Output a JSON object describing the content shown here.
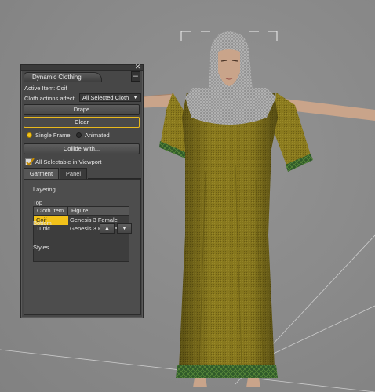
{
  "panel": {
    "title": "Dynamic Clothing",
    "close_glyph": "✕",
    "menu_glyph": "☰",
    "active_item": "Active Item: Coif",
    "actions_label": "Cloth actions affect:",
    "actions_value": "All Selected Cloth",
    "actions_arrow": "▼",
    "drape_label": "Drape",
    "clear_label": "Clear",
    "radio_single": "Single Frame",
    "radio_animated": "Animated",
    "collide_label": "Collide With...",
    "viewport_checkbox": "All Selectable in Viewport",
    "viewport_checked": true,
    "tabs": [
      "Garment",
      "Panel"
    ],
    "active_tab": "Garment",
    "layering_label": "Layering",
    "top_label": "Top",
    "table": {
      "headers": [
        "Cloth Item",
        "Figure"
      ],
      "rows": [
        {
          "item": "Coif",
          "figure": "Genesis 3 Female",
          "selected": true
        },
        {
          "item": "Tunic",
          "figure": "Genesis 3 Female",
          "selected": false
        }
      ]
    },
    "bottom_label": "Bottom",
    "up_glyph": "▲",
    "down_glyph": "▼",
    "styles_label": "Styles"
  },
  "colors": {
    "viewport_bg": "#8a8a8a",
    "panel_bg": "#474747",
    "accent": "#f2c21a",
    "tunic": "#8a7a1e",
    "trim": "#2f5a2a",
    "chainmail": "#9a9a9a",
    "skin": "#c9a48a"
  },
  "icons": [
    "close-icon",
    "panel-menu-icon",
    "checkmark-icon",
    "arrow-up-icon",
    "arrow-down-icon",
    "chevron-down-icon"
  ]
}
